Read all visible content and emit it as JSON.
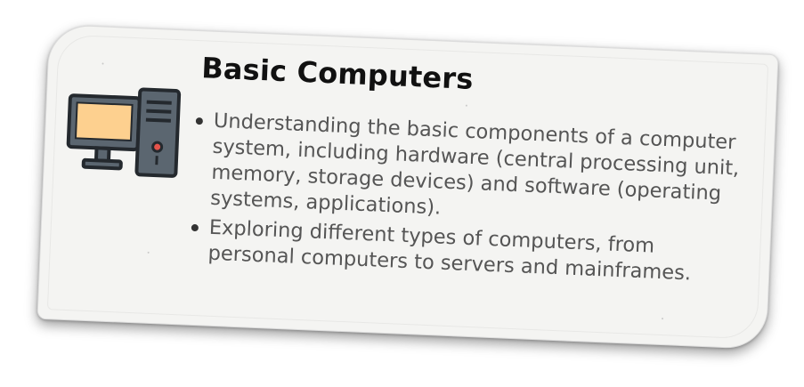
{
  "card": {
    "title": "Basic Computers",
    "icon": "desktop-computer-icon",
    "bullets": [
      "Understanding the basic components of a computer system, including hardware (central processing unit, memory, storage devices) and software (operating systems, applications).",
      "Exploring different types of computers, from personal computers to servers and mainframes."
    ]
  },
  "colors": {
    "card_background": "#f4f4f2",
    "title_text": "#111111",
    "body_text": "#555555",
    "monitor_screen": "#fdd08f",
    "icon_body": "#5b6670",
    "icon_outline": "#24292e",
    "power_button": "#e5534b"
  }
}
